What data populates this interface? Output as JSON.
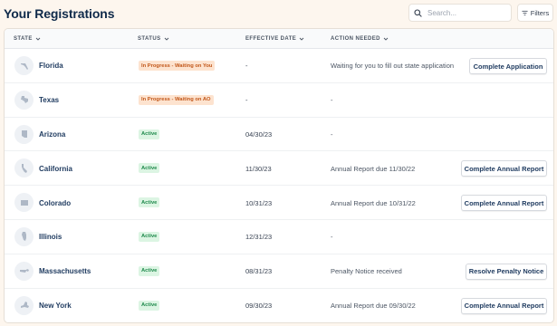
{
  "header": {
    "title": "Your Registrations",
    "search_placeholder": "Search...",
    "filters_label": "Filters"
  },
  "columns": {
    "state": "STATE",
    "status": "STATUS",
    "effective_date": "EFFECTIVE DATE",
    "action_needed": "ACTION NEEDED"
  },
  "rows": [
    {
      "state": "Florida",
      "status": "In Progress - Waiting on You",
      "status_type": "progress",
      "date": "-",
      "action": "Waiting for you to fill out state application",
      "button": "Complete Application"
    },
    {
      "state": "Texas",
      "status": "In Progress - Waiting on AO",
      "status_type": "progress",
      "date": "-",
      "action": "-",
      "button": ""
    },
    {
      "state": "Arizona",
      "status": "Active",
      "status_type": "active",
      "date": "04/30/23",
      "action": "-",
      "button": ""
    },
    {
      "state": "California",
      "status": "Active",
      "status_type": "active",
      "date": "11/30/23",
      "action": "Annual Report due 11/30/22",
      "button": "Complete Annual Report"
    },
    {
      "state": "Colorado",
      "status": "Active",
      "status_type": "active",
      "date": "10/31/23",
      "action": "Annual Report due 10/31/22",
      "button": "Complete Annual Report"
    },
    {
      "state": "Illinois",
      "status": "Active",
      "status_type": "active",
      "date": "12/31/23",
      "action": "-",
      "button": ""
    },
    {
      "state": "Massachusetts",
      "status": "Active",
      "status_type": "active",
      "date": "08/31/23",
      "action": "Penalty Notice received",
      "button": "Resolve Penalty Notice"
    },
    {
      "state": "New York",
      "status": "Active",
      "status_type": "active",
      "date": "09/30/23",
      "action": "Annual Report due 09/30/22",
      "button": "Complete Annual Report"
    }
  ],
  "colors": {
    "page_background": "#fdf6ee",
    "progress_badge_bg": "#fde3cf",
    "progress_badge_text": "#c2571a",
    "active_badge_bg": "#dcf5e3",
    "active_badge_text": "#1f8a4c",
    "title_navy": "#0f2a4a"
  }
}
